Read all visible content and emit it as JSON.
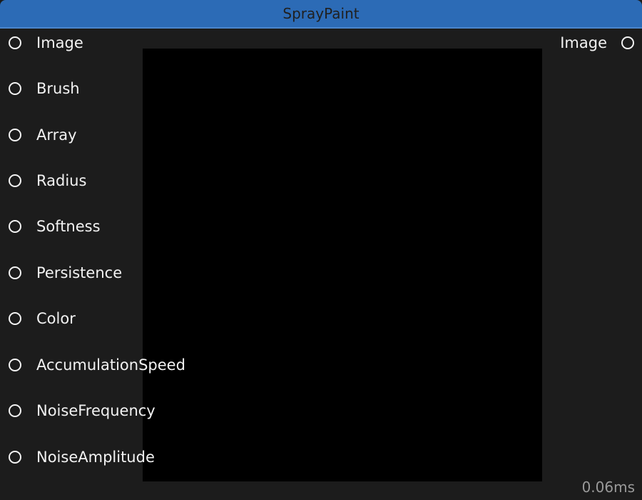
{
  "node": {
    "title": "SprayPaint",
    "inputs": [
      {
        "label": "Image"
      },
      {
        "label": "Brush"
      },
      {
        "label": "Array"
      },
      {
        "label": "Radius"
      },
      {
        "label": "Softness"
      },
      {
        "label": "Persistence"
      },
      {
        "label": "Color"
      },
      {
        "label": "AccumulationSpeed"
      },
      {
        "label": "NoiseFrequency"
      },
      {
        "label": "NoiseAmplitude"
      }
    ],
    "outputs": [
      {
        "label": "Image"
      }
    ],
    "timing": "0.06ms"
  },
  "colors": {
    "titlebar": "#2c6bb6",
    "background": "#1c1c1c",
    "preview": "#000000",
    "text": "#f2f2f2",
    "timing": "#9a9a9a"
  },
  "icons": {
    "port": "port-circle-icon"
  }
}
